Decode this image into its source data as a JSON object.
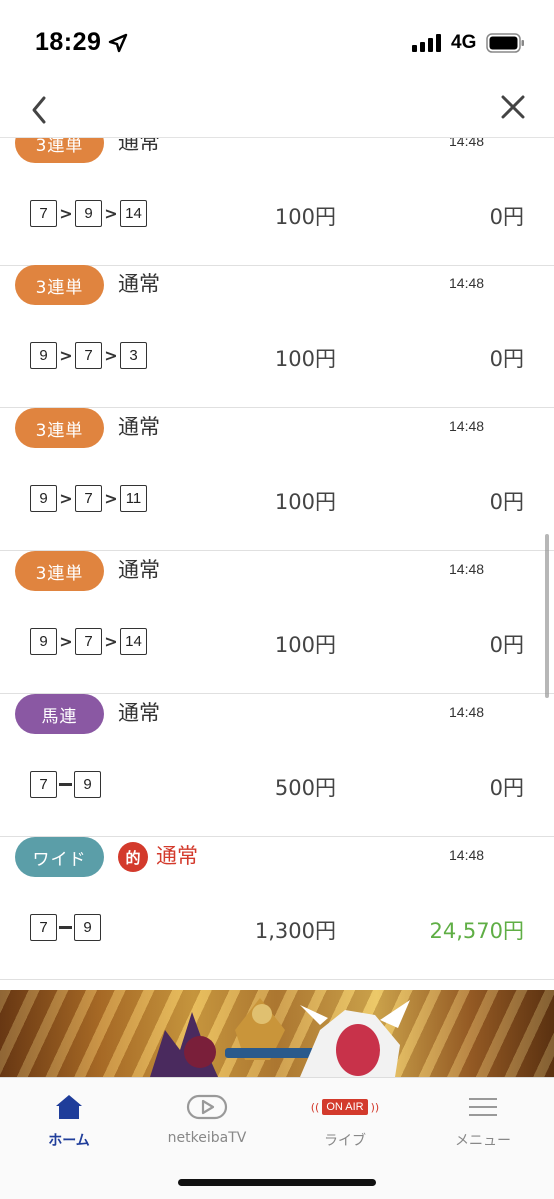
{
  "status_bar": {
    "time": "18:29",
    "network": "4G"
  },
  "bets": [
    {
      "type": "3連単",
      "type_color": "#e0843f",
      "method": "通常",
      "time": "14:48",
      "numbers": [
        "7",
        "9",
        "14"
      ],
      "separator": "arrow",
      "amount": "100円",
      "payout": "0円",
      "hit": false
    },
    {
      "type": "3連単",
      "type_color": "#e0843f",
      "method": "通常",
      "time": "14:48",
      "numbers": [
        "9",
        "7",
        "3"
      ],
      "separator": "arrow",
      "amount": "100円",
      "payout": "0円",
      "hit": false
    },
    {
      "type": "3連単",
      "type_color": "#e0843f",
      "method": "通常",
      "time": "14:48",
      "numbers": [
        "9",
        "7",
        "11"
      ],
      "separator": "arrow",
      "amount": "100円",
      "payout": "0円",
      "hit": false
    },
    {
      "type": "3連単",
      "type_color": "#e0843f",
      "method": "通常",
      "time": "14:48",
      "numbers": [
        "9",
        "7",
        "14"
      ],
      "separator": "arrow",
      "amount": "100円",
      "payout": "0円",
      "hit": false
    },
    {
      "type": "馬連",
      "type_color": "#8a58a3",
      "method": "通常",
      "time": "14:48",
      "numbers": [
        "7",
        "9"
      ],
      "separator": "dash",
      "amount": "500円",
      "payout": "0円",
      "hit": false
    },
    {
      "type": "ワイド",
      "type_color": "#5b9ea8",
      "method": "通常",
      "time": "14:48",
      "numbers": [
        "7",
        "9"
      ],
      "separator": "dash",
      "amount": "1,300円",
      "payout": "24,570円",
      "hit": true,
      "hit_badge": "的"
    }
  ],
  "tab_bar": {
    "tabs": [
      {
        "label": "ホーム",
        "icon": "home-icon",
        "active": true
      },
      {
        "label": "netkeibaTV",
        "icon": "play-icon",
        "active": false
      },
      {
        "label": "ライブ",
        "icon": "onair-icon",
        "active": false,
        "badge": "ON AIR"
      },
      {
        "label": "メニュー",
        "icon": "menu-icon",
        "active": false
      }
    ]
  },
  "colors": {
    "accent": "#1f3d9a",
    "hit_red": "#d33a2c",
    "win_green": "#5fae45"
  }
}
